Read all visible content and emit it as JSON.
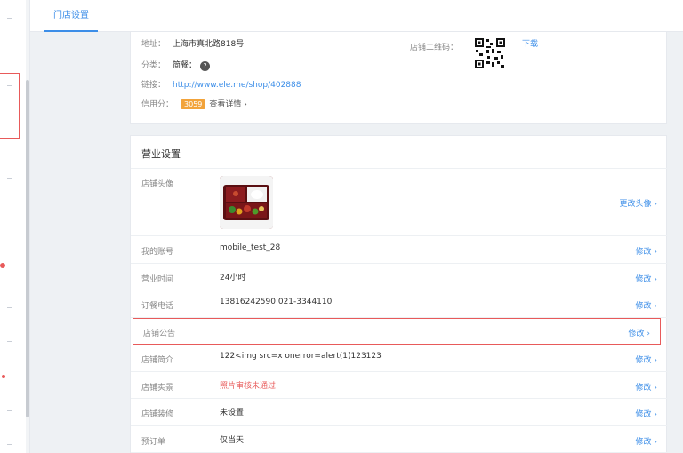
{
  "topbar": {
    "active_tab": "门店设置"
  },
  "shop_info": {
    "address_label": "地址：",
    "address_value": "上海市真北路818号",
    "category_label": "分类：",
    "category_value": "简餐：",
    "link_label": "链接：",
    "link_value": "http://www.ele.me/shop/402888",
    "credit_label": "信用分：",
    "credit_value": "3059",
    "credit_detail": "查看详情 ›",
    "qr_label": "店铺二维码：",
    "download_label": "下载"
  },
  "business": {
    "title": "营业设置",
    "avatar_label": "店铺头像",
    "avatar_action": "更改头像 ›",
    "rows": [
      {
        "label": "我的账号",
        "value": "mobile_test_28",
        "action": "修改 ›"
      },
      {
        "label": "营业时间",
        "value": "24小时",
        "action": "修改 ›"
      },
      {
        "label": "订餐电话",
        "value": "13816242590   021-3344110",
        "action": "修改 ›"
      },
      {
        "label": "店铺公告",
        "value": "",
        "action": "修改 ›"
      },
      {
        "label": "店铺简介",
        "value": "122<img src=x onerror=alert(1)123123",
        "action": "修改 ›"
      },
      {
        "label": "店铺实景",
        "value": "照片审核未通过",
        "action": "修改 ›"
      },
      {
        "label": "店铺装修",
        "value": "未设置",
        "action": "修改 ›"
      },
      {
        "label": "预订单",
        "value": "仅当天",
        "action": "修改 ›"
      }
    ]
  },
  "colors": {
    "accent": "#3c8ee8",
    "alert": "#e85a5a",
    "badge": "#f2a33a"
  }
}
